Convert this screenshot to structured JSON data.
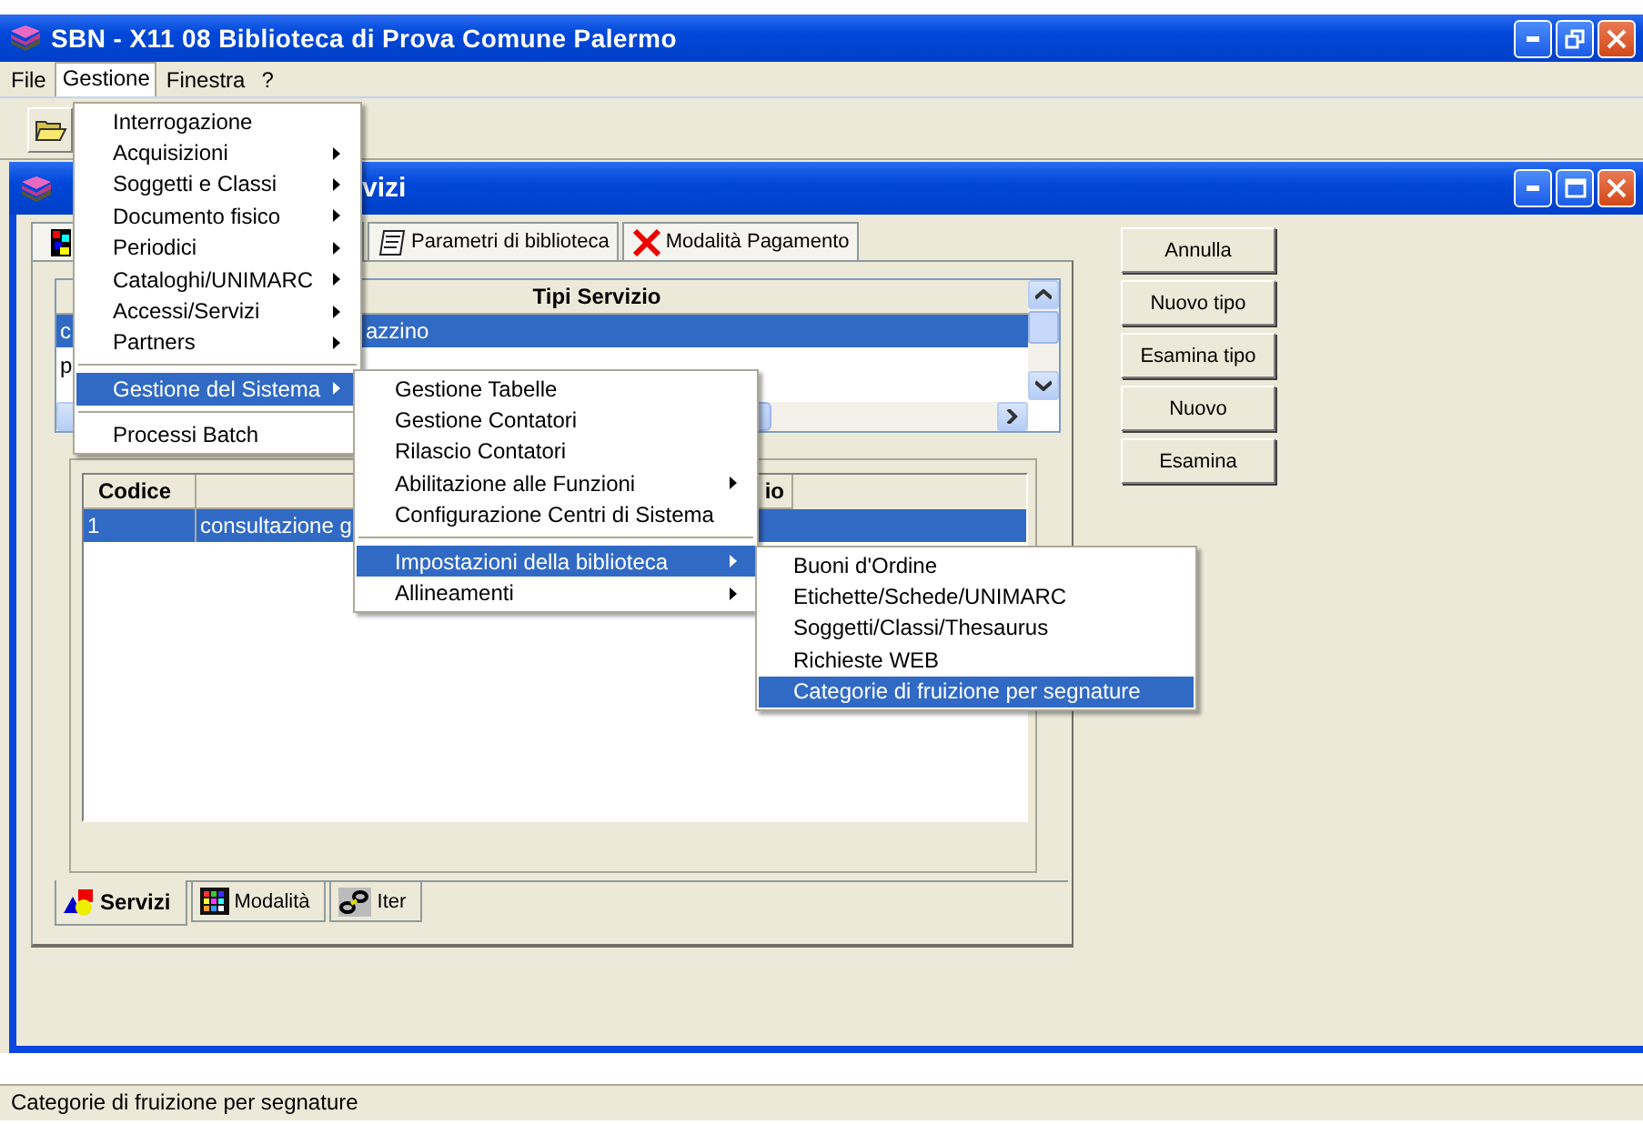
{
  "window": {
    "title": "SBN - X11 08 Biblioteca di Prova Comune Palermo"
  },
  "menu_bar": [
    {
      "label": "File",
      "selected": false
    },
    {
      "label": "Gestione",
      "selected": true
    },
    {
      "label": "Finestra",
      "selected": false
    },
    {
      "label": "?",
      "selected": false
    }
  ],
  "child_window": {
    "title": "vizi",
    "top_tabs": [
      {
        "label": "Parametri di biblioteca"
      },
      {
        "label": "Modalità Pagamento"
      }
    ],
    "services_table": {
      "header": "Tipi Servizio",
      "rows": [
        {
          "cells": [
            "c",
            "azzino"
          ],
          "selected": true
        },
        {
          "cells": [
            "p"
          ],
          "selected": false
        }
      ]
    },
    "lower_table": {
      "columns": [
        "Codice",
        "io"
      ],
      "rows": [
        {
          "cells": [
            "1",
            "consultazione g"
          ],
          "selected": true
        }
      ]
    },
    "bottom_tabs": [
      {
        "label": "Servizi",
        "selected": true
      },
      {
        "label": "Modalità",
        "selected": false
      },
      {
        "label": "Iter",
        "selected": false
      }
    ],
    "buttons": [
      "Annulla",
      "Nuovo tipo",
      "Esamina tipo",
      "Nuovo",
      "Esamina"
    ]
  },
  "menus": [
    {
      "items": [
        {
          "kind": "item",
          "label": "Interrogazione",
          "submenu": false,
          "selected": false
        },
        {
          "kind": "item",
          "label": "Acquisizioni",
          "submenu": true,
          "selected": false
        },
        {
          "kind": "item",
          "label": "Soggetti e Classi",
          "submenu": true,
          "selected": false
        },
        {
          "kind": "item",
          "label": "Documento fisico",
          "submenu": true,
          "selected": false
        },
        {
          "kind": "item",
          "label": "Periodici",
          "submenu": true,
          "selected": false
        },
        {
          "kind": "item",
          "label": "Cataloghi/UNIMARC",
          "submenu": true,
          "selected": false
        },
        {
          "kind": "item",
          "label": "Accessi/Servizi",
          "submenu": true,
          "selected": false
        },
        {
          "kind": "item",
          "label": "Partners",
          "submenu": true,
          "selected": false
        },
        {
          "kind": "separator"
        },
        {
          "kind": "item",
          "label": "Gestione del Sistema",
          "submenu": true,
          "selected": true
        },
        {
          "kind": "separator"
        },
        {
          "kind": "item",
          "label": "Processi Batch",
          "submenu": false,
          "selected": false
        }
      ]
    },
    {
      "items": [
        {
          "kind": "item",
          "label": "Gestione Tabelle",
          "submenu": false,
          "selected": false
        },
        {
          "kind": "item",
          "label": "Gestione Contatori",
          "submenu": false,
          "selected": false
        },
        {
          "kind": "item",
          "label": "Rilascio Contatori",
          "submenu": false,
          "selected": false
        },
        {
          "kind": "item",
          "label": "Abilitazione alle Funzioni",
          "submenu": true,
          "selected": false
        },
        {
          "kind": "item",
          "label": "Configurazione Centri di Sistema",
          "submenu": false,
          "selected": false
        },
        {
          "kind": "separator"
        },
        {
          "kind": "item",
          "label": "Impostazioni della biblioteca",
          "submenu": true,
          "selected": true
        },
        {
          "kind": "item",
          "label": "Allineamenti",
          "submenu": true,
          "selected": false
        }
      ]
    },
    {
      "items": [
        {
          "kind": "item",
          "label": "Buoni d'Ordine",
          "submenu": false,
          "selected": false
        },
        {
          "kind": "item",
          "label": "Etichette/Schede/UNIMARC",
          "submenu": false,
          "selected": false
        },
        {
          "kind": "item",
          "label": "Soggetti/Classi/Thesaurus",
          "submenu": false,
          "selected": false
        },
        {
          "kind": "item",
          "label": "Richieste WEB",
          "submenu": false,
          "selected": false
        },
        {
          "kind": "item",
          "label": "Categorie di fruizione per segnature",
          "submenu": false,
          "selected": true
        }
      ]
    }
  ],
  "status_bar": "Categorie di fruizione per segnature"
}
